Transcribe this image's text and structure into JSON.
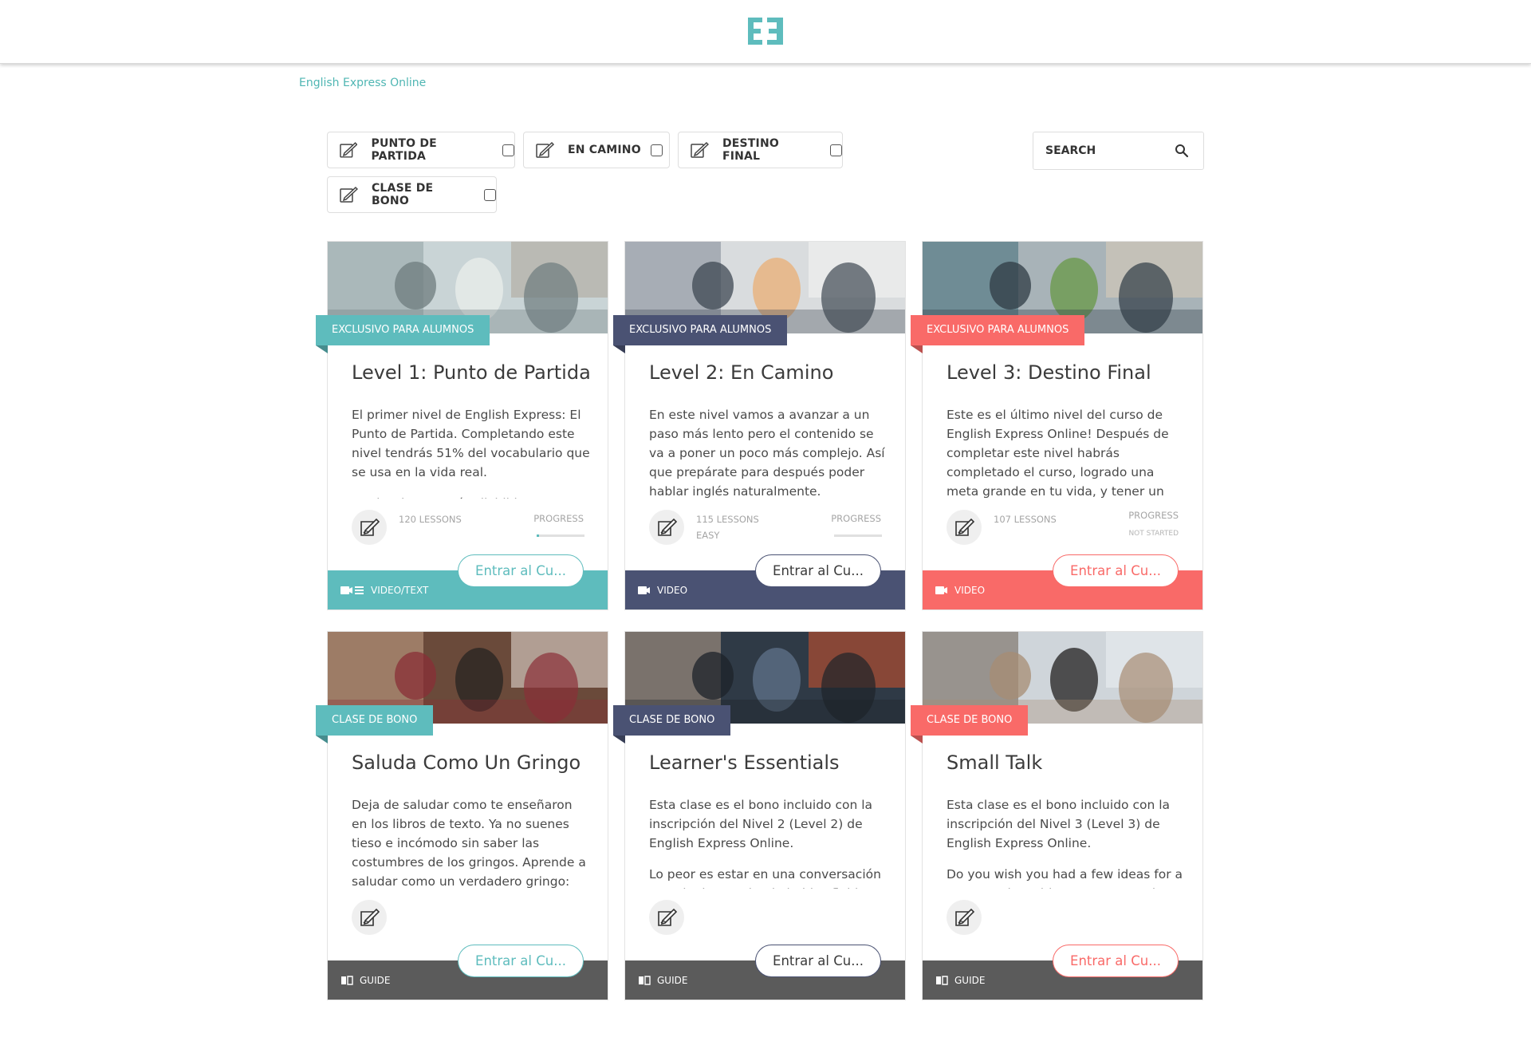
{
  "header": {
    "logo_icon": "ee-logo-icon",
    "brand_color": "#5ebcbd"
  },
  "breadcrumb": {
    "label": "English Express Online"
  },
  "filters": [
    {
      "label": "PUNTO DE PARTIDA",
      "checked": false
    },
    {
      "label": "EN CAMINO",
      "checked": false
    },
    {
      "label": "DESTINO FINAL",
      "checked": false
    },
    {
      "label": "CLASE DE BONO",
      "checked": false
    }
  ],
  "search": {
    "label": "SEARCH",
    "icon": "search-icon"
  },
  "colors": {
    "teal": "#5ebcbd",
    "navy": "#4a5273",
    "coral": "#f96a68",
    "gray": "#5b5b5b"
  },
  "cards": [
    {
      "ribbon": "EXCLUSIVO PARA ALUMNOS",
      "title": "Level 1: Punto de Partida",
      "description": [
        "El primer nivel de English Express: El Punto de Partida. Completando este nivel tendrás 51% del vocabulario que se usa en la vida real.",
        "Las lecciones están divididas"
      ],
      "lessons": "120 LESSONS",
      "difficulty": "",
      "progress_label": "PROGRESS",
      "progress_status": "",
      "progress": 0.05,
      "button": "Entrar al Cu...",
      "footer": "VIDEO/TEXT",
      "footer_icon": "video-text-icon",
      "color": "#5ebcbd"
    },
    {
      "ribbon": "EXCLUSIVO PARA ALUMNOS",
      "title": "Level 2: En Camino",
      "description": [
        "En este nivel vamos a avanzar a un paso más lento pero el contenido se va a poner un poco más complejo. Así que prepárate para después poder hablar inglés naturalmente."
      ],
      "lessons": "115 LESSONS",
      "difficulty": "EASY",
      "progress_label": "PROGRESS",
      "progress_status": "",
      "progress": 0,
      "button": "Entrar al Cu...",
      "footer": "VIDEO",
      "footer_icon": "video-icon",
      "color": "#4a5273"
    },
    {
      "ribbon": "EXCLUSIVO PARA ALUMNOS",
      "title": "Level 3: Destino Final",
      "description": [
        "Este es el último nivel del curso de English Express Online! Después de completar este nivel habrás completado el curso, logrado una meta grande en tu vida, y tener un"
      ],
      "lessons": "107 LESSONS",
      "difficulty": "",
      "progress_label": "PROGRESS",
      "progress_status": "NOT STARTED",
      "progress": 0,
      "button": "Entrar al Cu...",
      "footer": "VIDEO",
      "footer_icon": "video-icon",
      "color": "#f96a68"
    },
    {
      "ribbon": "CLASE DE BONO",
      "title": "Saluda Como Un Gringo",
      "description": [
        "Deja de saludar como te enseñaron en los libros de texto. Ya no suenes tieso e incómodo sin saber las costumbres de los gringos. Aprende a saludar como un verdadero gringo:"
      ],
      "lessons": "",
      "difficulty": "",
      "progress_label": "",
      "progress_status": "",
      "progress": null,
      "button": "Entrar al Cu...",
      "footer": "GUIDE",
      "footer_icon": "guide-book-icon",
      "color": "#5ebcbd"
    },
    {
      "ribbon": "CLASE DE BONO",
      "title": "Learner's Essentials",
      "description": [
        "Esta clase es el bono incluido con la inscripción del Nivel 2 (Level 2) de English Express Online.",
        "Lo peor es estar en una conversación con alguien en donde hablas fluido"
      ],
      "lessons": "",
      "difficulty": "",
      "progress_label": "",
      "progress_status": "",
      "progress": null,
      "button": "Entrar al Cu...",
      "footer": "GUIDE",
      "footer_icon": "guide-book-icon",
      "color": "#4a5273"
    },
    {
      "ribbon": "CLASE DE BONO",
      "title": "Small Talk",
      "description": [
        "Esta clase es el bono incluido con la inscripción del Nivel 3 (Level 3) de English Express Online.",
        "Do you wish you had a few ideas for a conversation with someone you don't"
      ],
      "lessons": "",
      "difficulty": "",
      "progress_label": "",
      "progress_status": "",
      "progress": null,
      "button": "Entrar al Cu...",
      "footer": "GUIDE",
      "footer_icon": "guide-book-icon",
      "color": "#f96a68"
    }
  ]
}
